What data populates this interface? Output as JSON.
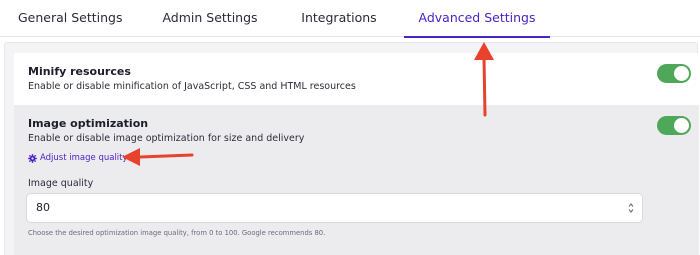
{
  "tabs": [
    {
      "label": "General Settings",
      "active": false
    },
    {
      "label": "Admin Settings",
      "active": false
    },
    {
      "label": "Integrations",
      "active": false
    },
    {
      "label": "Advanced Settings",
      "active": true
    }
  ],
  "settings": {
    "minify": {
      "title": "Minify resources",
      "description": "Enable or disable minification of JavaScript, CSS and HTML resources",
      "enabled": true
    },
    "image_optimization": {
      "title": "Image optimization",
      "description": "Enable or disable image optimization for size and delivery",
      "enabled": true,
      "adjust_link": "Adjust image quality",
      "quality_label": "Image quality",
      "quality_value": "80",
      "help_text": "Choose the desired optimization image quality, from 0 to 100. Google recommends 80."
    }
  },
  "colors": {
    "accent": "#4b22c4",
    "toggle_on": "#4fa85a",
    "annotation_arrow": "#e8412c"
  },
  "icons": {
    "adjust_link_icon": "gear-icon",
    "input_stepper_icon": "stepper-icon"
  }
}
